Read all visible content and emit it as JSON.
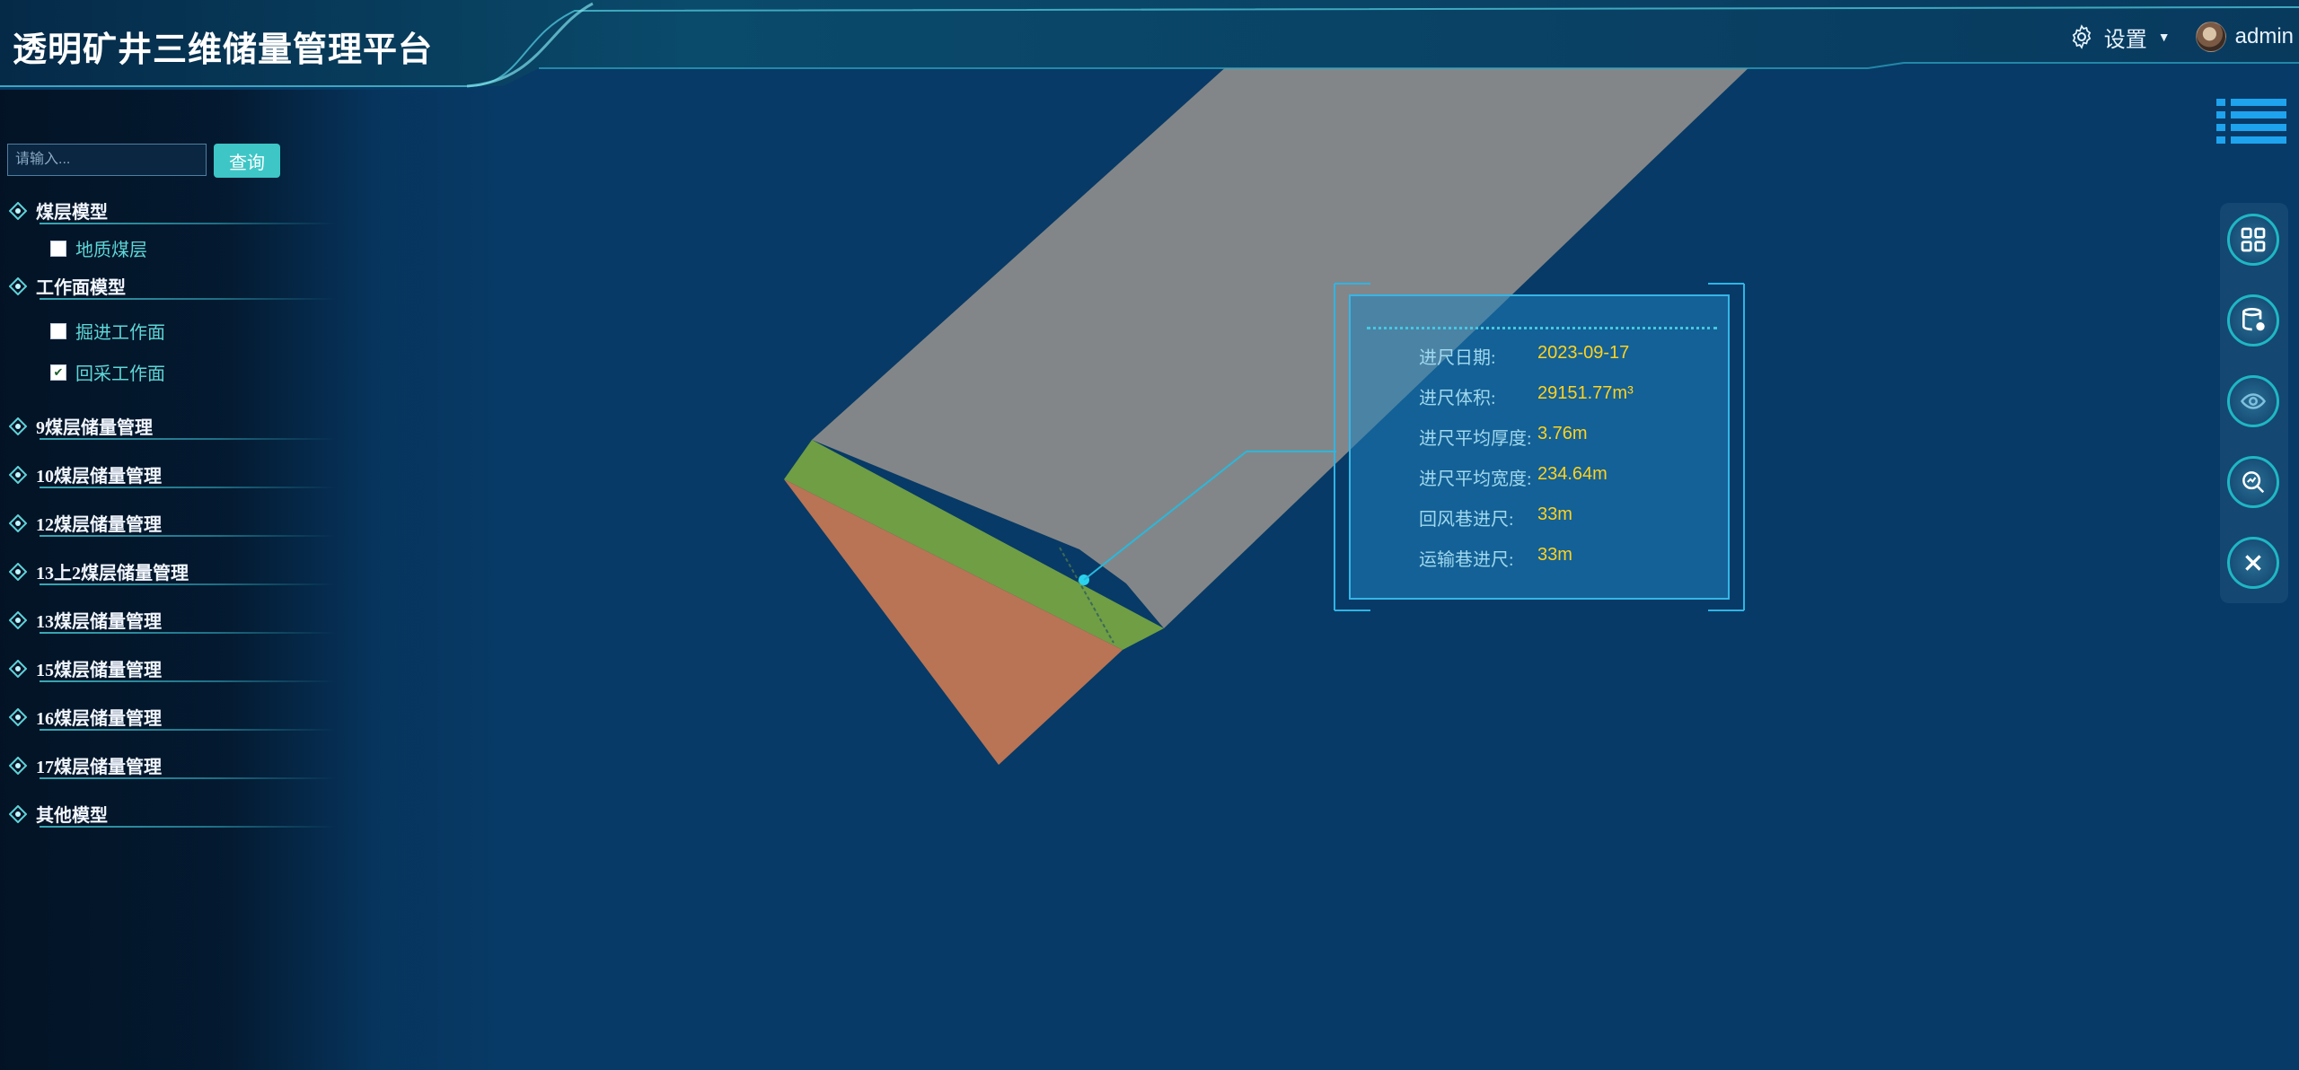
{
  "app": {
    "title": "透明矿井三维储量管理平台"
  },
  "header": {
    "settings": {
      "label": "设置",
      "icon": "gear-icon"
    },
    "user": {
      "name": "admin",
      "icon": "avatar"
    }
  },
  "search": {
    "placeholder": "请输入...",
    "button_label": "查询"
  },
  "tree": {
    "coal_seam_model": {
      "label": "煤层模型",
      "children": [
        {
          "label": "地质煤层",
          "checked": false
        }
      ]
    },
    "working_face_model": {
      "label": "工作面模型",
      "children": [
        {
          "label": "掘进工作面",
          "checked": false
        },
        {
          "label": "回采工作面",
          "checked": true
        }
      ]
    },
    "groups": [
      {
        "label": "9煤层储量管理"
      },
      {
        "label": "10煤层储量管理"
      },
      {
        "label": "12煤层储量管理"
      },
      {
        "label": "13上2煤层储量管理"
      },
      {
        "label": "13煤层储量管理"
      },
      {
        "label": "15煤层储量管理"
      },
      {
        "label": "16煤层储量管理"
      },
      {
        "label": "17煤层储量管理"
      },
      {
        "label": "其他模型"
      }
    ]
  },
  "toolbar": {
    "menu_icon": "list-icon",
    "buttons": [
      {
        "name": "layout-grid-button",
        "icon": "grid-icon"
      },
      {
        "name": "database-button",
        "icon": "database-icon"
      },
      {
        "name": "visibility-button",
        "icon": "eye-icon"
      },
      {
        "name": "analysis-button",
        "icon": "magnify-chart-icon"
      },
      {
        "name": "close-button",
        "icon": "close-icon"
      }
    ]
  },
  "info_popup": {
    "rows": [
      {
        "label": "进尺日期:",
        "value": "2023-09-17"
      },
      {
        "label": "进尺体积:",
        "value": "29151.77m³"
      },
      {
        "label": "进尺平均厚度:",
        "value": "3.76m"
      },
      {
        "label": "进尺平均宽度:",
        "value": "234.64m"
      },
      {
        "label": "回风巷进尺:",
        "value": "33m"
      },
      {
        "label": "运输巷进尺:",
        "value": "33m"
      }
    ]
  },
  "colors": {
    "background": "#073a66",
    "accent": "#3ec6c6",
    "value_text": "#ffd21f",
    "mined_area": "#8a8a8a",
    "advance_strip": "#6f9e45",
    "coal_seam": "#b87455"
  }
}
